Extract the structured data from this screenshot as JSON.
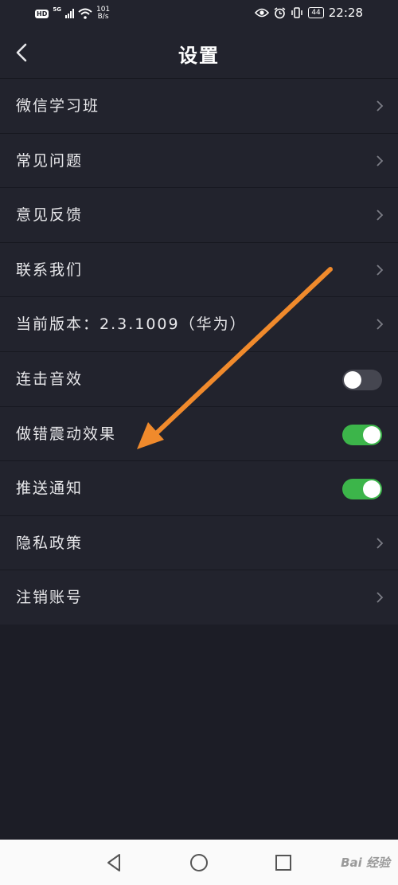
{
  "status_bar": {
    "network_badge": "HD",
    "signal_type": "5G",
    "net_speed_value": "101",
    "net_speed_unit": "B/s",
    "battery": "44",
    "time": "22:28"
  },
  "header": {
    "title": "设置",
    "back_icon": "chevron-left-icon"
  },
  "settings": {
    "items": [
      {
        "label": "微信学习班",
        "control": "chevron"
      },
      {
        "label": "常见问题",
        "control": "chevron"
      },
      {
        "label": "意见反馈",
        "control": "chevron"
      },
      {
        "label": "联系我们",
        "control": "chevron"
      },
      {
        "label": "当前版本：2.3.1009（华为）",
        "control": "chevron"
      },
      {
        "label": "连击音效",
        "control": "toggle",
        "on": false
      },
      {
        "label": "做错震动效果",
        "control": "toggle",
        "on": true
      },
      {
        "label": "推送通知",
        "control": "toggle",
        "on": true
      },
      {
        "label": "隐私政策",
        "control": "chevron"
      },
      {
        "label": "注销账号",
        "control": "chevron"
      }
    ]
  },
  "annotation": {
    "type": "arrow",
    "color": "#f08a2c"
  },
  "nav_bar": {
    "buttons": [
      "back-triangle-icon",
      "home-circle-icon",
      "recents-square-icon"
    ],
    "watermark": "Bai 经验"
  },
  "colors": {
    "background": "#1c1d26",
    "panel": "#22232d",
    "toggle_on": "#3cb54a",
    "toggle_off": "#454650",
    "arrow": "#f08a2c"
  }
}
